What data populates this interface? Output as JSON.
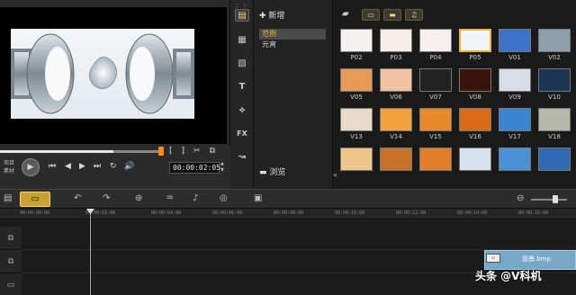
{
  "preview": {
    "mode_project": "项目",
    "mode_clip": "素材",
    "timecode": "00:00:02:05",
    "controls": {
      "play": "▶",
      "home": "⏮",
      "prev_frame": "◀",
      "next_frame": "▶",
      "end": "⏭",
      "repeat": "↻",
      "volume": "🔊"
    },
    "trim_icons": [
      "[",
      "]",
      "✂",
      "⧉"
    ],
    "progress": 0.7
  },
  "library": {
    "add_label": "新增",
    "folders": [
      "范例",
      "元宵"
    ],
    "browse_label": "浏览",
    "side_buttons": [
      "▤",
      "▦",
      "▧",
      "T",
      "⟡",
      "FX",
      "↝"
    ]
  },
  "gallery": {
    "toolbar_icons": [
      "▭",
      "▬",
      "♫"
    ],
    "thumbnails": [
      {
        "label": "P02",
        "color": "#f4f1ee"
      },
      {
        "label": "P03",
        "color": "#f7efe7"
      },
      {
        "label": "P04",
        "color": "#f7efef"
      },
      {
        "label": "P05",
        "color": "#f2f5f8"
      },
      {
        "label": "V01",
        "color": "#3a73c8"
      },
      {
        "label": "V02",
        "color": "#8ea0a9"
      },
      {
        "label": "V05",
        "color": "#e89a57"
      },
      {
        "label": "V06",
        "color": "#f3c2a2"
      },
      {
        "label": "V07",
        "color": "#222222"
      },
      {
        "label": "V08",
        "color": "#3a1408"
      },
      {
        "label": "V09",
        "color": "#d7dde6"
      },
      {
        "label": "V10",
        "color": "#1c3555"
      },
      {
        "label": "V13",
        "color": "#e8d9c8"
      },
      {
        "label": "V14",
        "color": "#f2a23c"
      },
      {
        "label": "V15",
        "color": "#e88a2a"
      },
      {
        "label": "V16",
        "color": "#d86a18"
      },
      {
        "label": "V17",
        "color": "#3b86d1"
      },
      {
        "label": "V18",
        "color": "#b7b9a8"
      },
      {
        "label": "",
        "color": "#f0c78a"
      },
      {
        "label": "",
        "color": "#c9722a"
      },
      {
        "label": "",
        "color": "#e27d2a"
      },
      {
        "label": "",
        "color": "#d8e2ee"
      },
      {
        "label": "",
        "color": "#4b91d8"
      },
      {
        "label": "",
        "color": "#2f6bb4"
      }
    ]
  },
  "timeline": {
    "ruler": [
      "00:00:00:00",
      "00:00:02:00",
      "00:00:04:00",
      "00:00:06:00",
      "00:00:08:00",
      "00:00:10:00",
      "00:00:12:00",
      "00:00:14:00",
      "00:00:16:00"
    ],
    "clip_label": "前景.bmp",
    "track_icons": [
      "⧉",
      "⧉",
      "▭"
    ]
  },
  "watermark": "头条 @V科机",
  "colors": {
    "accent": "#f0b23c",
    "orange_thumb": "#ff8a1e",
    "clip": "#78a8c8"
  }
}
